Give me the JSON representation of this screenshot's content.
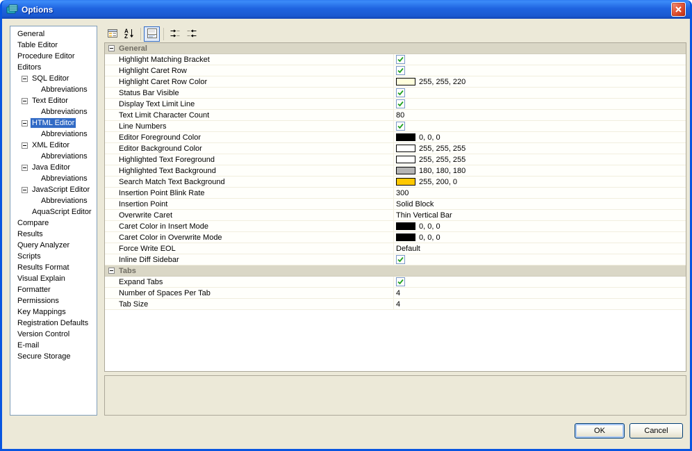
{
  "window": {
    "title": "Options"
  },
  "colors": {
    "selection": "#316ac5",
    "dialog_bg": "#ece9d8",
    "titlebar_blue": "#1f64e0",
    "check_green": "#21a121"
  },
  "toolbar": {
    "icons": [
      "categorized-view-icon",
      "sort-alphabetical-icon",
      "|",
      "show-description-icon",
      "|",
      "expand-all-icon",
      "collapse-all-icon"
    ],
    "pressed": "show-description-icon"
  },
  "sidebar": {
    "items": [
      {
        "label": "General",
        "level": 0
      },
      {
        "label": "Table Editor",
        "level": 0
      },
      {
        "label": "Procedure Editor",
        "level": 0
      },
      {
        "label": "Editors",
        "level": 0
      },
      {
        "label": "SQL Editor",
        "level": 1,
        "expandable": true
      },
      {
        "label": "Abbreviations",
        "level": 2
      },
      {
        "label": "Text Editor",
        "level": 1,
        "expandable": true
      },
      {
        "label": "Abbreviations",
        "level": 2
      },
      {
        "label": "HTML Editor",
        "level": 1,
        "expandable": true,
        "selected": true
      },
      {
        "label": "Abbreviations",
        "level": 2
      },
      {
        "label": "XML Editor",
        "level": 1,
        "expandable": true
      },
      {
        "label": "Abbreviations",
        "level": 2
      },
      {
        "label": "Java Editor",
        "level": 1,
        "expandable": true
      },
      {
        "label": "Abbreviations",
        "level": 2
      },
      {
        "label": "JavaScript Editor",
        "level": 1,
        "expandable": true
      },
      {
        "label": "Abbreviations",
        "level": 2
      },
      {
        "label": "AquaScript Editor",
        "level": 1
      },
      {
        "label": "Compare",
        "level": 0
      },
      {
        "label": "Results",
        "level": 0
      },
      {
        "label": "Query Analyzer",
        "level": 0
      },
      {
        "label": "Scripts",
        "level": 0
      },
      {
        "label": "Results Format",
        "level": 0
      },
      {
        "label": "Visual Explain",
        "level": 0
      },
      {
        "label": "Formatter",
        "level": 0
      },
      {
        "label": "Permissions",
        "level": 0
      },
      {
        "label": "Key Mappings",
        "level": 0
      },
      {
        "label": "Registration Defaults",
        "level": 0
      },
      {
        "label": "Version Control",
        "level": 0
      },
      {
        "label": "E-mail",
        "level": 0
      },
      {
        "label": "Secure Storage",
        "level": 0
      }
    ]
  },
  "properties": {
    "groups": [
      {
        "name": "General",
        "rows": [
          {
            "label": "Highlight Matching Bracket",
            "type": "checkbox",
            "checked": true
          },
          {
            "label": "Highlight Caret Row",
            "type": "checkbox",
            "checked": true
          },
          {
            "label": "Highlight Caret Row Color",
            "type": "color",
            "swatch": "#ffffdc",
            "value": "255, 255, 220"
          },
          {
            "label": "Status Bar Visible",
            "type": "checkbox",
            "checked": true
          },
          {
            "label": "Display Text Limit Line",
            "type": "checkbox",
            "checked": true
          },
          {
            "label": "Text Limit Character Count",
            "type": "text",
            "value": "80"
          },
          {
            "label": "Line Numbers",
            "type": "checkbox",
            "checked": true
          },
          {
            "label": "Editor Foreground Color",
            "type": "color",
            "swatch": "#000000",
            "value": "0, 0, 0"
          },
          {
            "label": "Editor Background Color",
            "type": "color",
            "swatch": "#ffffff",
            "value": "255, 255, 255"
          },
          {
            "label": "Highlighted Text Foreground",
            "type": "color",
            "swatch": "#ffffff",
            "value": "255, 255, 255"
          },
          {
            "label": "Highlighted Text Background",
            "type": "color",
            "swatch": "#b4b4b4",
            "value": "180, 180, 180"
          },
          {
            "label": "Search Match Text Background",
            "type": "color",
            "swatch": "#ffc800",
            "value": "255, 200, 0"
          },
          {
            "label": "Insertion Point Blink Rate",
            "type": "text",
            "value": "300"
          },
          {
            "label": "Insertion Point",
            "type": "text",
            "value": "Solid Block"
          },
          {
            "label": "Overwrite Caret",
            "type": "text",
            "value": "Thin Vertical Bar"
          },
          {
            "label": "Caret Color in Insert Mode",
            "type": "color",
            "swatch": "#000000",
            "value": "0, 0, 0"
          },
          {
            "label": "Caret Color in Overwrite Mode",
            "type": "color",
            "swatch": "#000000",
            "value": "0, 0, 0"
          },
          {
            "label": "Force Write EOL",
            "type": "text",
            "value": "Default"
          },
          {
            "label": "Inline Diff Sidebar",
            "type": "checkbox",
            "checked": true
          }
        ]
      },
      {
        "name": "Tabs",
        "rows": [
          {
            "label": "Expand Tabs",
            "type": "checkbox",
            "checked": true
          },
          {
            "label": "Number of Spaces Per Tab",
            "type": "text",
            "value": "4"
          },
          {
            "label": "Tab Size",
            "type": "text",
            "value": "4"
          }
        ]
      }
    ]
  },
  "description_panel": {
    "text": ""
  },
  "buttons": {
    "ok": "OK",
    "cancel": "Cancel"
  }
}
